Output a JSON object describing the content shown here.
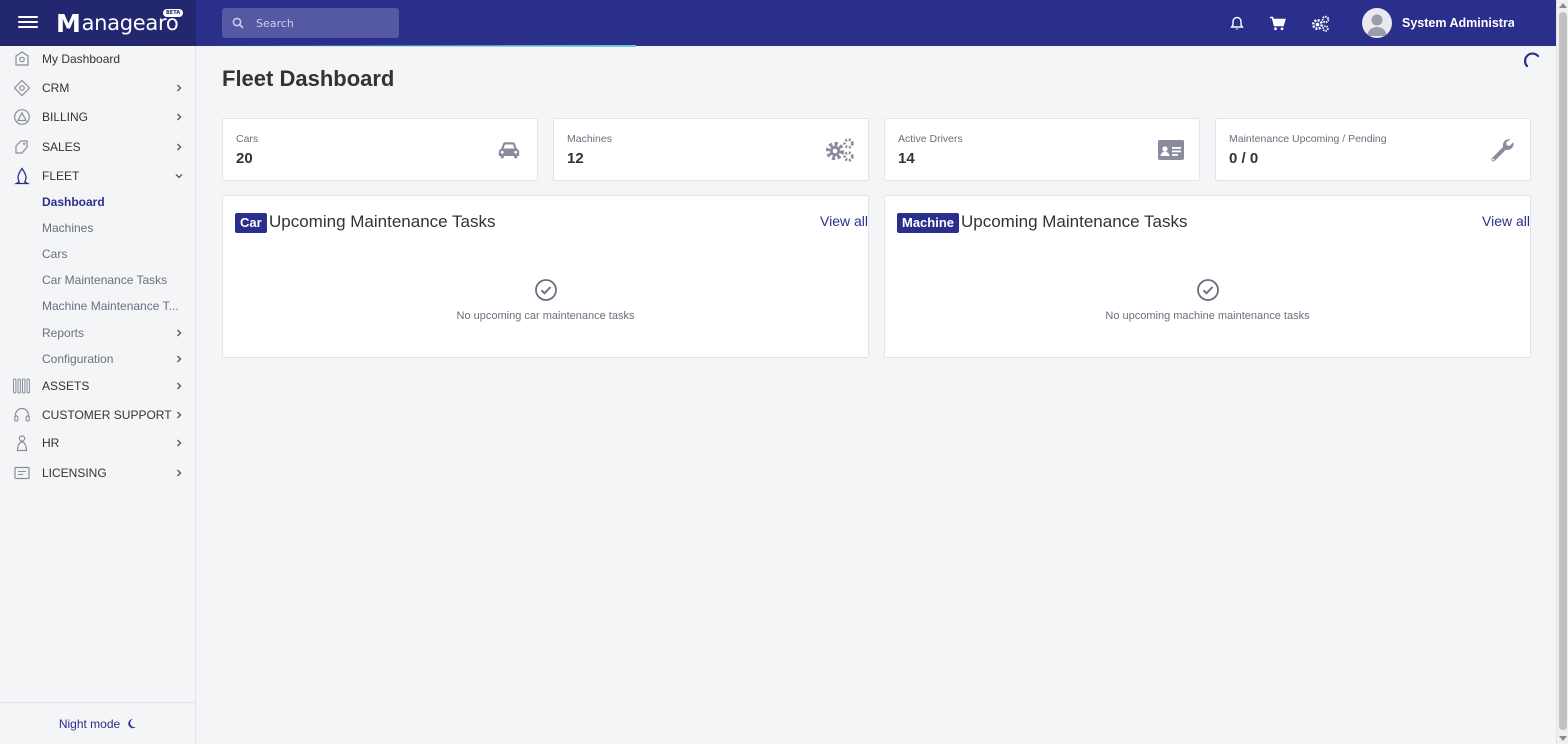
{
  "header": {
    "logo_text": "anagearo",
    "logo_initial": "M",
    "beta_badge": "BETA",
    "search_placeholder": "Search",
    "user_name": "System Administrat..."
  },
  "sidebar": {
    "items": [
      {
        "label": "My Dashboard",
        "icon": "dashboard-icon"
      },
      {
        "label": "CRM",
        "icon": "crm-icon"
      },
      {
        "label": "BILLING",
        "icon": "billing-icon"
      },
      {
        "label": "SALES",
        "icon": "sales-icon"
      },
      {
        "label": "FLEET",
        "icon": "fleet-icon"
      },
      {
        "label": "ASSETS",
        "icon": "assets-icon"
      },
      {
        "label": "CUSTOMER SUPPORT",
        "icon": "headset-icon"
      },
      {
        "label": "HR",
        "icon": "person-icon"
      },
      {
        "label": "LICENSING",
        "icon": "license-icon"
      }
    ],
    "fleet_sub": [
      "Dashboard",
      "Machines",
      "Cars",
      "Car Maintenance Tasks",
      "Machine Maintenance T...",
      "Reports",
      "Configuration"
    ],
    "night_mode": "Night mode"
  },
  "main": {
    "title": "Fleet Dashboard",
    "stats": [
      {
        "label": "Cars",
        "value": "20",
        "icon": "car-icon"
      },
      {
        "label": "Machines",
        "value": "12",
        "icon": "gears-icon"
      },
      {
        "label": "Active Drivers",
        "value": "14",
        "icon": "id-card-icon"
      },
      {
        "label": "Maintenance Upcoming / Pending",
        "value": "0 / 0",
        "icon": "wrench-icon"
      }
    ],
    "panels": [
      {
        "badge": "Car",
        "title": "Upcoming Maintenance Tasks",
        "view_all": "View all",
        "empty": "No upcoming car maintenance tasks"
      },
      {
        "badge": "Machine",
        "title": "Upcoming Maintenance Tasks",
        "view_all": "View all",
        "empty": "No upcoming machine maintenance tasks"
      }
    ]
  },
  "colors": {
    "primary": "#2b2f8c",
    "brand_dark": "#23276f",
    "background": "#f4f5f7"
  }
}
